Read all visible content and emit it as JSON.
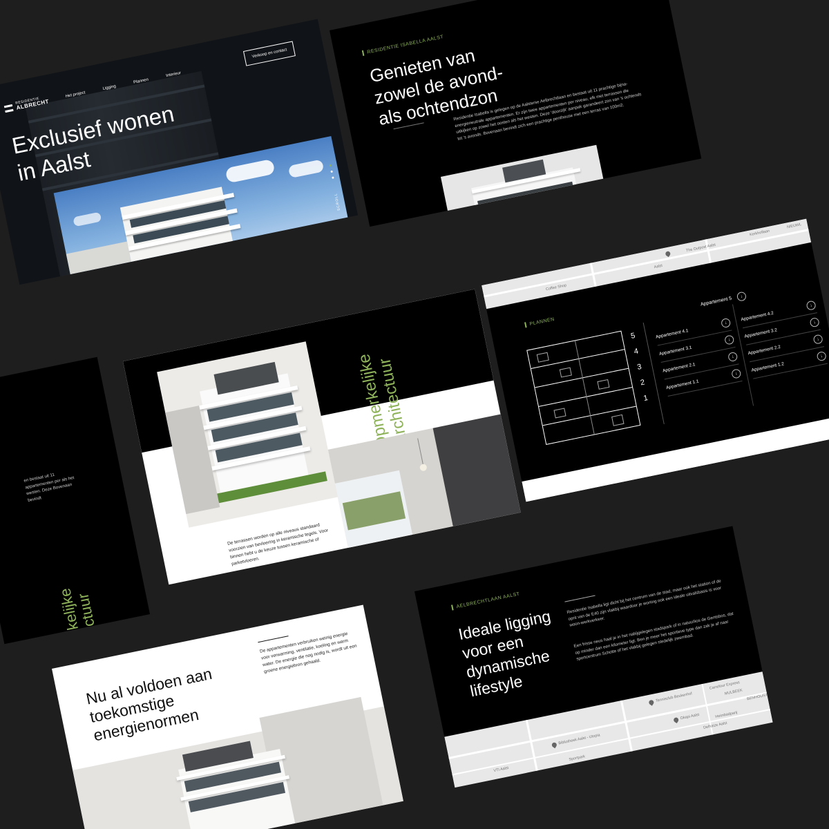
{
  "brand": {
    "line1": "RESIDENTIE",
    "line2": "ALBRECHT"
  },
  "nav": {
    "items": [
      "Het project",
      "Ligging",
      "Plannen",
      "Interieur"
    ],
    "cta": "Verkoop en contact"
  },
  "hero": {
    "title": "Exclusief wonen in Aalst",
    "scroll": "SCROLL"
  },
  "intro": {
    "eyebrow": "RESIDENTIE ISABELLA AALST",
    "title": "Genieten van zowel de avond- als ochtendzon",
    "text": "Residentie Isabella is gelegen op de Aalsterse Aelbrechtlaan en bestaat uit 11 prachtige bijna-energieneutrale appartementen. Er zijn twee appartementen per niveau, elk met terrassen die uitkijken op zowel het oosten als het westen. Deze 'doorzijk' aanpak garandeert zon van 's ochtends tot 's avonds. Bovenaan bevindt zich een prachtige penthouse met een terras van 100m2."
  },
  "left_fragment": {
    "text": "en bestaat uit 11 appartementen per als het westen. Deze Bovenaan bevindt",
    "title": "kelijke ctuur"
  },
  "architecture": {
    "title": "Opmerkelijke Architectuur",
    "text": "De terrassen worden op alle niveaus standaard voorzien van bevloering in keramische tegels. Voor binnen hebt u de keuze tussen keramische of parketvloeren."
  },
  "plans": {
    "eyebrow": "PLANNEN",
    "floors": [
      "5",
      "4",
      "3",
      "2",
      "1"
    ],
    "penthouse": "Appartement 5",
    "left": [
      "Appartement 4.1",
      "Appartement 3.1",
      "Appartement 2.1",
      "Appartement 1.1"
    ],
    "right": [
      "Appartement 4.2",
      "Appartement 3.2",
      "Appartement 2.2",
      "Appartement 1.2"
    ],
    "map_labels": [
      "The Outpost Aalst",
      "Kerkhoflaan",
      "Aalst",
      "NIEUWL",
      "Coffee Shop"
    ]
  },
  "energy": {
    "title": "Nu al voldoen aan toekomstige energienormen",
    "text": "De appartementen verbruiken weinig energie voor verwarming, ventilatie, koeling en warm water. De energie die nog nodig is, wordt uit een groene energiebron gehaald."
  },
  "location": {
    "eyebrow": "AELBRECHTLAAN AALST",
    "title": "Ideale ligging voor een dynamische lifestyle",
    "text1": "Residentie Isabella ligt dicht bij het centrum van de stad, maar ook het station of de oprit van de E40 zijn vlakbij waardoor je woning ook een ideale uitvalsbasis is voor woon-werkverkeer.",
    "text2": "Een frisse neus haal je in het nabijgelegen stadspark of in natuurlios de Gentsbos, dat op minder dan een kilometer ligt. Ben je meer het sportieve type dan zak je af naar sportcentrum Schotte of het vlakbij gelegen stedelijk zwembad.",
    "map_labels": [
      "Tennisclub Beukenhof",
      "Carrefour Express",
      "MULBEEK",
      "BENHOUSTE",
      "Bibliotheek Aalst - Utopia",
      "Okapi Aalst",
      "Heimbadparij",
      "Delhaize Aalst",
      "VTI Aalst",
      "Sportpark"
    ]
  },
  "colors": {
    "background": "#1e1e1e",
    "accent": "#8fb35a",
    "card_dark": "#000000",
    "card_light": "#ffffff"
  }
}
